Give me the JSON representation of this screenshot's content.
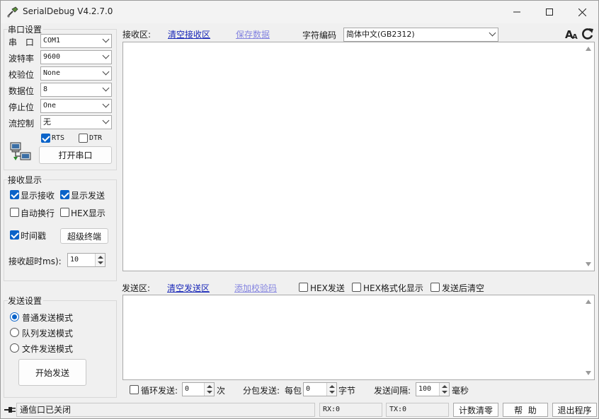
{
  "window": {
    "title": "SerialDebug V4.2.7.0"
  },
  "serial_settings": {
    "group_label": "串口设置",
    "port": {
      "label": "串  口",
      "value": "COM1"
    },
    "baud": {
      "label": "波特率",
      "value": "9600"
    },
    "parity": {
      "label": "校验位",
      "value": "None"
    },
    "databits": {
      "label": "数据位",
      "value": "8"
    },
    "stopbits": {
      "label": "停止位",
      "value": "One"
    },
    "flow": {
      "label": "流控制",
      "value": "无"
    },
    "rts": {
      "label": "RTS",
      "checked": true
    },
    "dtr": {
      "label": "DTR",
      "checked": false
    },
    "open_button": "打开串口"
  },
  "receive_display": {
    "group_label": "接收显示",
    "show_receive": {
      "label": "显示接收",
      "checked": true
    },
    "show_send": {
      "label": "显示发送",
      "checked": true
    },
    "auto_wrap": {
      "label": "自动换行",
      "checked": false
    },
    "hex_display": {
      "label": "HEX显示",
      "checked": false
    },
    "timestamp": {
      "label": "时间戳",
      "checked": true
    },
    "super_terminal_button": "超级终端",
    "timeout": {
      "label": "接收超时ms):",
      "value": "10"
    }
  },
  "send_settings": {
    "group_label": "发送设置",
    "modes": [
      {
        "label": "普通发送模式",
        "selected": true
      },
      {
        "label": "队列发送模式",
        "selected": false
      },
      {
        "label": "文件发送模式",
        "selected": false
      }
    ],
    "start_button": "开始发送"
  },
  "receive_area": {
    "label": "接收区:",
    "clear_link": "清空接收区",
    "save_link": "保存数据",
    "encoding_label": "字符编码",
    "encoding_value": "简体中文(GB2312)"
  },
  "send_area": {
    "label": "发送区:",
    "clear_link": "清空发送区",
    "checksum_link": "添加校验码",
    "hex_send": {
      "label": "HEX发送",
      "checked": false
    },
    "hex_format": {
      "label": "HEX格式化显示",
      "checked": false
    },
    "clear_after": {
      "label": "发送后清空",
      "checked": false
    }
  },
  "bottom_controls": {
    "loop_send": {
      "label": "循环发送:",
      "checked": false,
      "value": "0",
      "unit": "次"
    },
    "packet_label": "分包发送:",
    "per_packet_label": "每包",
    "per_packet_value": "0",
    "per_packet_unit": "字节",
    "interval_label": "发送间隔:",
    "interval_value": "100",
    "interval_unit": "毫秒"
  },
  "status_bar": {
    "status_text": "通信口已关闭",
    "rx": "RX:0",
    "tx": "TX:0",
    "reset_count_button": "计数清零",
    "help_button": "帮  助",
    "exit_button": "退出程序"
  },
  "colors": {
    "accent": "#0a63c9",
    "link": "#1a28b8",
    "link_disabled": "#8484e0"
  }
}
